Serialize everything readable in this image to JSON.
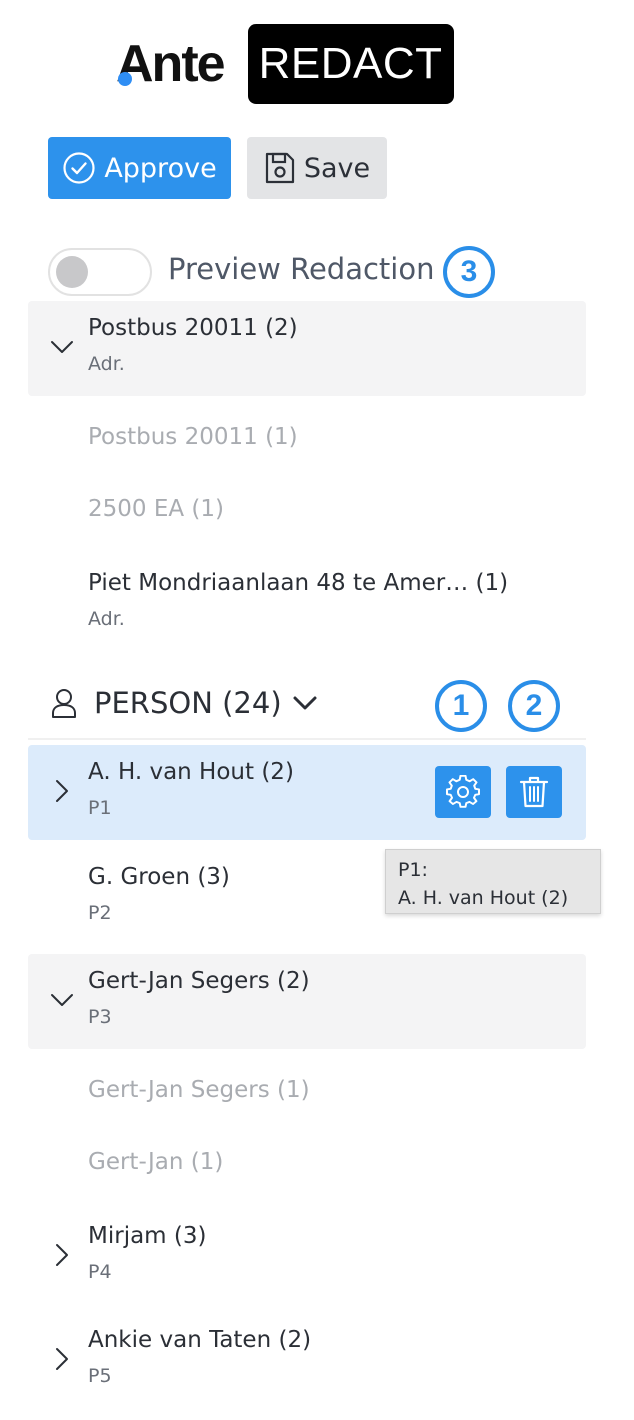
{
  "logo": {
    "brand": "Ante",
    "product": "REDACT"
  },
  "toolbar": {
    "approve_label": "Approve",
    "save_label": "Save"
  },
  "preview": {
    "label": "Preview Redaction",
    "enabled": false
  },
  "badges": {
    "one": "1",
    "two": "2",
    "three": "3"
  },
  "address_items": [
    {
      "title": "Postbus 20011 (2)",
      "sub": "Adr."
    },
    {
      "title": "Postbus 20011 (1)"
    },
    {
      "title": "2500 EA (1)"
    },
    {
      "title": "Piet Mondriaanlaan 48 te Amer…  (1)",
      "sub": "Adr."
    }
  ],
  "person_section": {
    "title": "PERSON (24)"
  },
  "person_items": [
    {
      "title": "A. H. van Hout (2)",
      "sub": "P1"
    },
    {
      "title": "G. Groen (3)",
      "sub": "P2"
    },
    {
      "title": "Gert-Jan Segers (2)",
      "sub": "P3"
    },
    {
      "title": "Gert-Jan Segers (1)"
    },
    {
      "title": "Gert-Jan (1)"
    },
    {
      "title": "Mirjam (3)",
      "sub": "P4"
    },
    {
      "title": "Ankie van Taten (2)",
      "sub": "P5"
    }
  ],
  "tooltip": {
    "line1": "P1:",
    "line2": "A. H. van Hout (2)"
  },
  "colors": {
    "accent": "#2d92ec",
    "selected_row": "#dcebfb",
    "group_row": "#f4f4f5"
  }
}
